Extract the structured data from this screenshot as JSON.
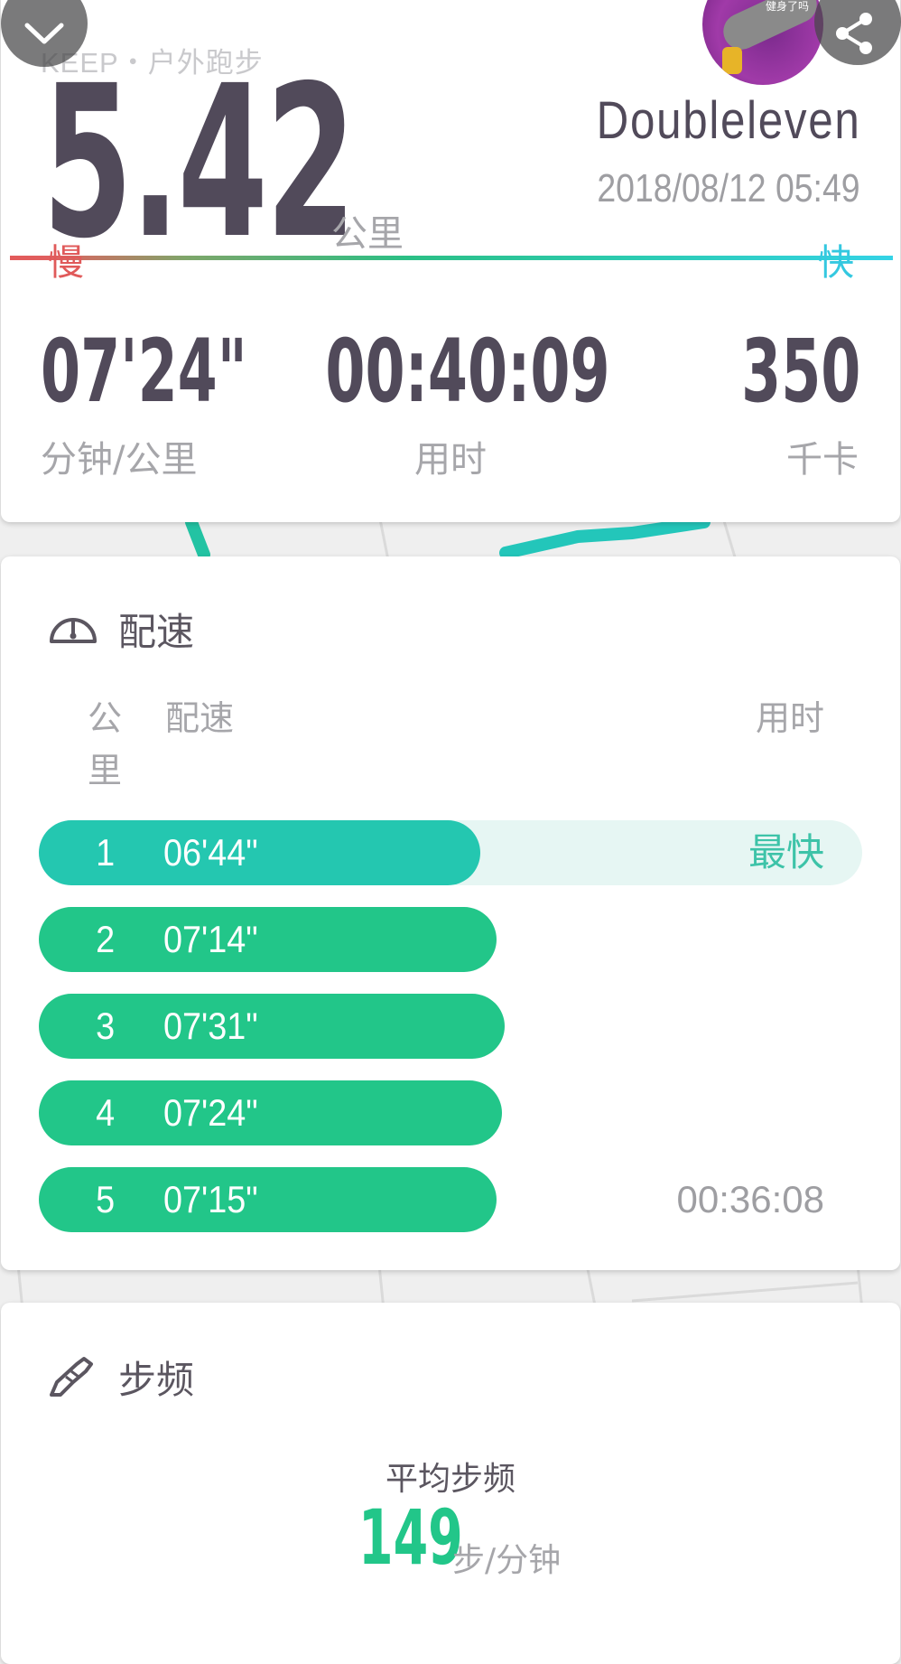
{
  "header": {
    "brand": "KEEP・户外跑步",
    "distance": "5.42",
    "distance_unit": "公里",
    "username": "Doubleleven",
    "datetime": "2018/08/12 05:49",
    "speed_slow_label": "慢",
    "speed_fast_label": "快",
    "avatar_text": "健身了吗"
  },
  "stats": {
    "pace_value": "07'24\"",
    "pace_label": "分钟/公里",
    "duration_value": "00:40:09",
    "duration_label": "用时",
    "calories_value": "350",
    "calories_label": "千卡"
  },
  "pace_section": {
    "title": "配速",
    "col_km": "公里",
    "col_pace": "配速",
    "col_time": "用时",
    "rows": [
      {
        "km": "1",
        "pace": "06'44\"",
        "right": "最快",
        "fraction": 0.536
      },
      {
        "km": "2",
        "pace": "07'14\"",
        "right": "",
        "fraction": 0.556
      },
      {
        "km": "3",
        "pace": "07'31\"",
        "right": "",
        "fraction": 0.566
      },
      {
        "km": "4",
        "pace": "07'24\"",
        "right": "",
        "fraction": 0.562
      },
      {
        "km": "5",
        "pace": "07'15\"",
        "right": "00:36:08",
        "fraction": 0.556
      }
    ]
  },
  "cadence_section": {
    "title": "步频",
    "avg_label": "平均步频",
    "avg_value": "149",
    "unit": "步/分钟"
  },
  "colors": {
    "accent_green": "#22c689",
    "fastest_teal": "#24c7b0",
    "fastest_track": "#e6f6f3",
    "dark_text": "#514a5a",
    "slow_red": "#e05a5a",
    "fast_cyan": "#34c8e0"
  },
  "icons": [
    "chevron-down-icon",
    "share-icon",
    "speedometer-icon",
    "shoe-icon"
  ]
}
